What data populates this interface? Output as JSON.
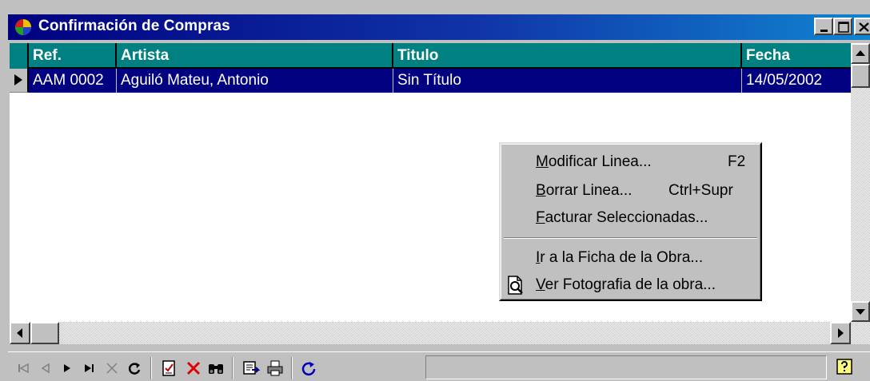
{
  "window": {
    "title": "Confirmación de Compras"
  },
  "grid": {
    "columns": [
      "Ref.",
      "Artista",
      "Titulo",
      "Fecha"
    ],
    "rows": [
      {
        "ref": "AAM 0002",
        "artista": "Aguiló Mateu, Antonio",
        "titulo": "Sin Título",
        "fecha": "14/05/2002"
      }
    ]
  },
  "context_menu": {
    "items": [
      {
        "mnemonic": "M",
        "rest": "odificar Linea...",
        "shortcut": "F2"
      },
      {
        "mnemonic": "B",
        "rest": "orrar Linea...",
        "shortcut": "Ctrl+Supr"
      },
      {
        "mnemonic": "F",
        "rest": "acturar Seleccionadas...",
        "shortcut": ""
      },
      {
        "mnemonic": "I",
        "rest": "r a la Ficha de la Obra...",
        "shortcut": ""
      },
      {
        "mnemonic": "V",
        "rest": "er Fotografia de la obra...",
        "shortcut": ""
      }
    ]
  },
  "toolbar": {
    "icons": [
      "first-record-icon",
      "prev-record-icon",
      "next-record-icon",
      "last-record-icon",
      "cancel-edit-icon",
      "refresh-icon",
      "edit-document-icon",
      "delete-icon",
      "binoculars-icon",
      "export-icon",
      "print-icon",
      "reload-icon",
      "help-icon"
    ]
  },
  "colors": {
    "titlebar_start": "#000080",
    "titlebar_end": "#1084d0",
    "header_bg": "#008080",
    "selected_row_bg": "#000080",
    "face": "#c0c0c0"
  }
}
